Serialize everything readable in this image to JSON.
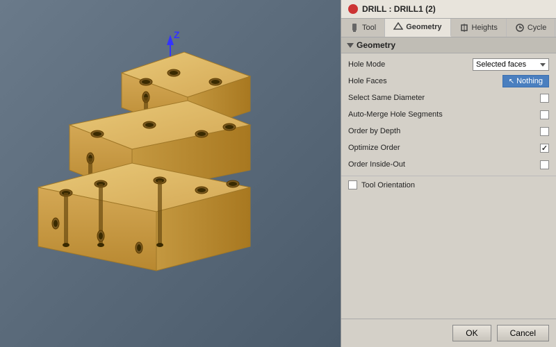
{
  "title_bar": {
    "icon_color": "#cc3333",
    "title": "DRILL : DRILL1 (2)"
  },
  "tabs": [
    {
      "label": "Tool",
      "active": false,
      "icon": "tool-icon"
    },
    {
      "label": "Geometry",
      "active": true,
      "icon": "geometry-icon"
    },
    {
      "label": "Heights",
      "active": false,
      "icon": "heights-icon"
    },
    {
      "label": "Cycle",
      "active": false,
      "icon": "cycle-icon"
    }
  ],
  "section": {
    "title": "Geometry"
  },
  "form": {
    "hole_mode": {
      "label": "Hole Mode",
      "value": "Selected faces"
    },
    "hole_faces": {
      "label": "Hole Faces",
      "btn_label": "Nothing"
    },
    "select_same_diameter": {
      "label": "Select Same Diameter",
      "checked": false
    },
    "auto_merge": {
      "label": "Auto-Merge Hole Segments",
      "checked": false
    },
    "order_by_depth": {
      "label": "Order by Depth",
      "checked": false
    },
    "optimize_order": {
      "label": "Optimize Order",
      "checked": true
    },
    "order_inside_out": {
      "label": "Order Inside-Out",
      "checked": false
    }
  },
  "tool_orientation": {
    "label": "Tool Orientation"
  },
  "footer": {
    "ok_label": "OK",
    "cancel_label": "Cancel"
  }
}
